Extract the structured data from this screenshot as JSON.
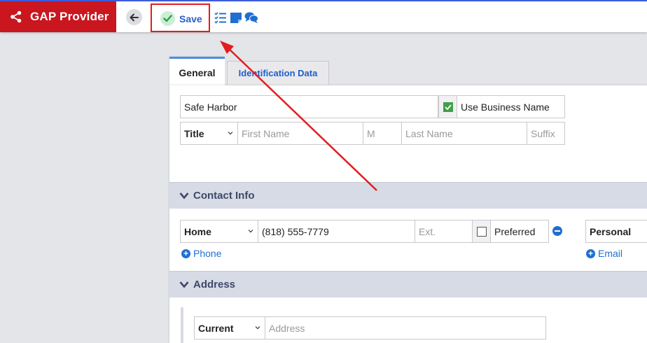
{
  "app": {
    "title": "GAP Provider",
    "brand_color": "#c9161f",
    "accent_color": "#1f6fd1"
  },
  "toolbar": {
    "save_label": "Save",
    "icons": [
      "share-icon",
      "back-arrow-icon",
      "check-icon",
      "checklist-icon",
      "note-icon",
      "comments-icon"
    ]
  },
  "tabs": [
    {
      "label": "General",
      "active": true
    },
    {
      "label": "Identification Data",
      "active": false
    }
  ],
  "general": {
    "business_name": "Safe Harbor",
    "use_business_name_label": "Use Business Name",
    "use_business_name_checked": true,
    "title_select": "Title",
    "first_name_placeholder": "First Name",
    "middle_placeholder": "M",
    "last_name_placeholder": "Last Name",
    "suffix_placeholder": "Suffix"
  },
  "contact": {
    "section_title": "Contact Info",
    "phone_type": "Home",
    "phone_number": "(818) 555-7779",
    "ext_placeholder": "Ext.",
    "preferred_label": "Preferred",
    "preferred_checked": false,
    "email_type": "Personal",
    "add_phone_label": "Phone",
    "add_email_label": "Email"
  },
  "address": {
    "section_title": "Address",
    "address_type": "Current",
    "address_placeholder": "Address"
  },
  "annotation": {
    "color": "#e21d1d"
  }
}
